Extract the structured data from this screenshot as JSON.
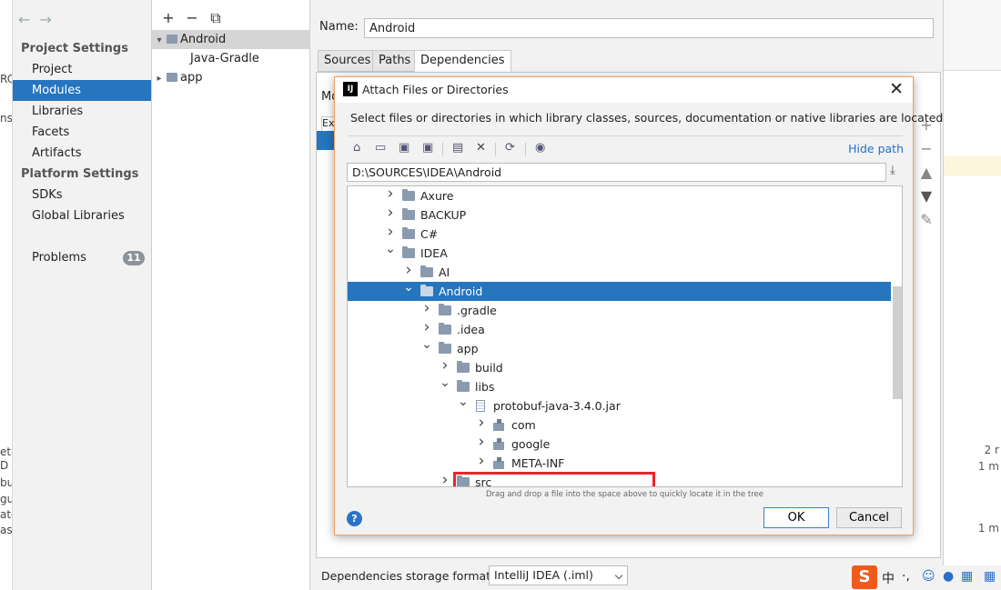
{
  "window": {
    "nav_back": "←",
    "nav_forward": "→"
  },
  "background": {
    "left_fragments": [
      "RC",
      "nso",
      "ete",
      "D",
      "bu",
      "gur",
      "ate",
      "ask"
    ],
    "right_fragments": [
      "2 r",
      "1 m",
      "1 m"
    ]
  },
  "sidebar": {
    "project_settings_header": "Project Settings",
    "project_items": [
      "Project",
      "Modules",
      "Libraries",
      "Facets",
      "Artifacts"
    ],
    "selected_item": "Modules",
    "platform_settings_header": "Platform Settings",
    "platform_items": [
      "SDKs",
      "Global Libraries"
    ],
    "problems_label": "Problems",
    "problems_count": "11"
  },
  "modules_tree": {
    "toolbar": {
      "add": "+",
      "remove": "−",
      "copy": "⧉"
    },
    "items": [
      {
        "label": "Android",
        "arrow": "▾"
      },
      {
        "label": "Java-Gradle"
      },
      {
        "label": "app",
        "arrow": "▸"
      }
    ]
  },
  "detail": {
    "name_label": "Name:",
    "name_value": "Android",
    "tabs": [
      "Sources",
      "Paths",
      "Dependencies"
    ],
    "selected_tab": "Dependencies",
    "partial_labels": [
      "Mo",
      "Ex"
    ],
    "side_tools": [
      "+",
      "−",
      "▲",
      "▼",
      "✎"
    ],
    "storage_label": "Dependencies storage format:",
    "storage_value": "IntelliJ IDEA (.iml)"
  },
  "dialog": {
    "logo": "IJ",
    "title": "Attach Files or Directories",
    "close": "✕",
    "description": "Select files or directories in which library classes, sources, documentation or native libraries are located",
    "toolbar_icons": [
      "home-icon",
      "desktop-icon",
      "project-folder-icon",
      "module-folder-icon",
      "new-folder-icon",
      "delete-icon",
      "refresh-icon",
      "show-hidden-icon"
    ],
    "hide_path": "Hide path",
    "path_value": "D:\\SOURCES\\IDEA\\Android",
    "tree_rows": [
      {
        "label": "Axure",
        "expanded": false,
        "depth": 0,
        "icon": "folder"
      },
      {
        "label": "BACKUP",
        "expanded": false,
        "depth": 0,
        "icon": "folder"
      },
      {
        "label": "C#",
        "expanded": false,
        "depth": 0,
        "icon": "folder"
      },
      {
        "label": "IDEA",
        "expanded": true,
        "depth": 0,
        "icon": "folder"
      },
      {
        "label": "AI",
        "expanded": false,
        "depth": 1,
        "icon": "folder"
      },
      {
        "label": "Android",
        "expanded": true,
        "depth": 1,
        "icon": "folder",
        "selected": true
      },
      {
        "label": ".gradle",
        "expanded": false,
        "depth": 2,
        "icon": "folder"
      },
      {
        "label": ".idea",
        "expanded": false,
        "depth": 2,
        "icon": "folder"
      },
      {
        "label": "app",
        "expanded": true,
        "depth": 2,
        "icon": "folder"
      },
      {
        "label": "build",
        "expanded": false,
        "depth": 3,
        "icon": "folder"
      },
      {
        "label": "libs",
        "expanded": true,
        "depth": 3,
        "icon": "folder"
      },
      {
        "label": "protobuf-java-3.4.0.jar",
        "expanded": true,
        "depth": 4,
        "icon": "jar",
        "highlighted": true
      },
      {
        "label": "com",
        "expanded": false,
        "depth": 5,
        "icon": "package"
      },
      {
        "label": "google",
        "expanded": false,
        "depth": 5,
        "icon": "package"
      },
      {
        "label": "META-INF",
        "expanded": false,
        "depth": 5,
        "icon": "package"
      },
      {
        "label": "src",
        "expanded": false,
        "depth": 3,
        "icon": "folder"
      }
    ],
    "dnd_hint": "Drag and drop a file into the space above to quickly locate it in the tree",
    "help": "?",
    "ok_label": "OK",
    "cancel_label": "Cancel"
  },
  "tray": {
    "ime_logo": "S",
    "ime_mode": "中",
    "icons": [
      "punctuation-icon",
      "emoji-icon",
      "microphone-icon",
      "keyboard-icon",
      "grid-icon"
    ]
  }
}
